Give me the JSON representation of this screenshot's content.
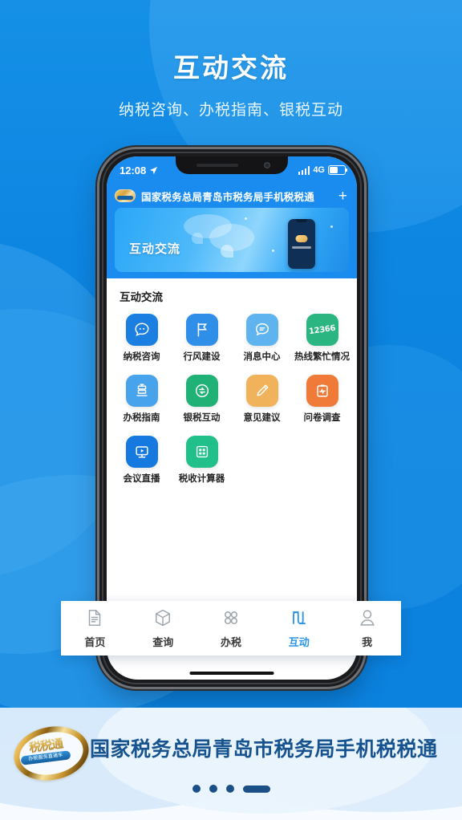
{
  "hero": {
    "title": "互动交流",
    "subtitle": "纳税咨询、办税指南、银税互动"
  },
  "phone": {
    "status_bar": {
      "time": "12:08",
      "network": "4G"
    },
    "app_header": {
      "title": "国家税务总局青岛市税务局手机税税通",
      "add_label": "+"
    },
    "banner": {
      "text": "互动交流"
    },
    "section_title": "互动交流",
    "grid": [
      {
        "label": "纳税咨询",
        "icon": "chat-bubble-icon",
        "color": "#1a7fe0"
      },
      {
        "label": "行风建设",
        "icon": "flag-icon",
        "color": "#2f8ee8"
      },
      {
        "label": "消息中心",
        "icon": "message-icon",
        "color": "#5fb3ef"
      },
      {
        "label": "热线繁忙情况",
        "icon": "hotline-12366-icon",
        "color": "#2bb581",
        "badge": "12366"
      },
      {
        "label": "办税指南",
        "icon": "guide-book-icon",
        "color": "#47a3ec"
      },
      {
        "label": "银税互动",
        "icon": "bank-exchange-icon",
        "color": "#20b176"
      },
      {
        "label": "意见建议",
        "icon": "pencil-icon",
        "color": "#f0b35c"
      },
      {
        "label": "问卷调查",
        "icon": "clipboard-icon",
        "color": "#f07b39"
      },
      {
        "label": "会议直播",
        "icon": "video-live-icon",
        "color": "#1679e0"
      },
      {
        "label": "税收计算器",
        "icon": "calculator-icon",
        "color": "#21c08a"
      }
    ],
    "tabbar": {
      "active_color": "#2a94e8",
      "items": [
        {
          "label": "首页",
          "icon": "document-icon",
          "active": false
        },
        {
          "label": "查询",
          "icon": "cube-icon",
          "active": false
        },
        {
          "label": "办税",
          "icon": "grid-icon",
          "active": false
        },
        {
          "label": "互动",
          "icon": "interaction-icon",
          "active": true
        },
        {
          "label": "我",
          "icon": "person-icon",
          "active": false
        }
      ]
    }
  },
  "footer": {
    "logo": {
      "chars": "税税通",
      "subtitle": "办税服务直通车"
    },
    "title": "国家税务总局青岛市税务局手机税税通",
    "pager": {
      "total": 4,
      "active_index": 3
    }
  },
  "colors": {
    "background": "#0b82de",
    "accent": "#1a8cf0",
    "footer_title": "#16538f"
  }
}
